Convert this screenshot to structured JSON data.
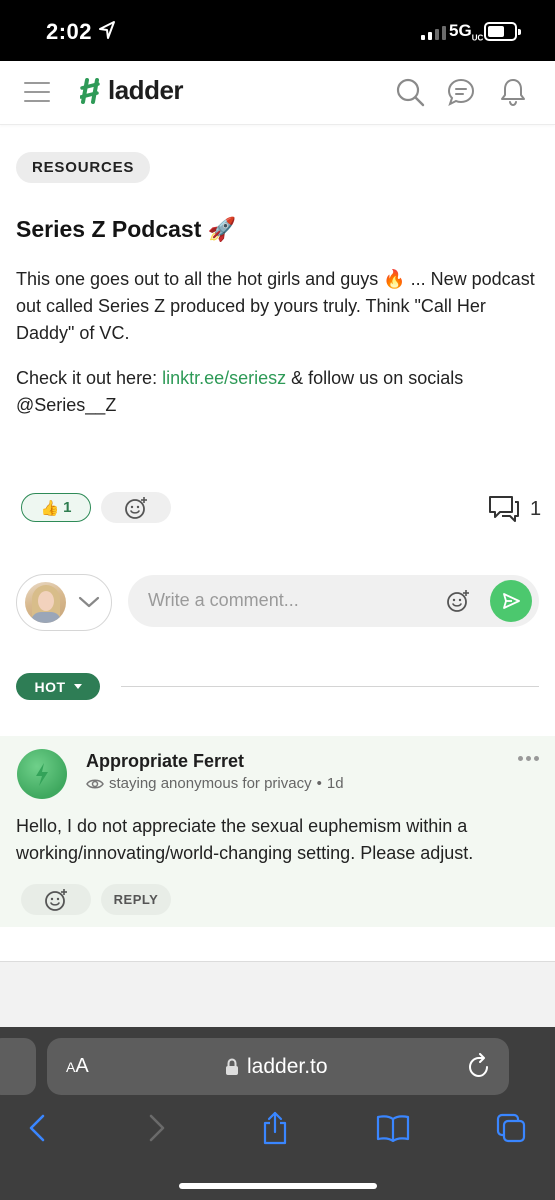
{
  "status_bar": {
    "time": "2:02",
    "network": "5G",
    "network_suffix": "UC"
  },
  "header": {
    "brand": "ladder",
    "brand_color": "#2e9a57",
    "icons": [
      "menu-icon",
      "search-icon",
      "messages-icon",
      "notifications-icon"
    ]
  },
  "post": {
    "category": "RESOURCES",
    "title": "Series Z Podcast",
    "title_emoji": "🚀",
    "paragraph1": "This one goes out to all the hot girls and guys 🔥 ... New podcast out called Series Z produced by yours truly. Think \"Call Her Daddy\" of VC.",
    "paragraph2_prefix": "Check it out here: ",
    "link_text": "linktr.ee/seriesz",
    "paragraph2_suffix": " & follow us on socials @Series__Z",
    "like_emoji": "👍",
    "like_count": "1",
    "comment_count": "1"
  },
  "composer": {
    "placeholder": "Write a comment...",
    "send_color": "#4cc86e"
  },
  "sort": {
    "label": "HOT",
    "color": "#2e7d55"
  },
  "comment": {
    "author": "Appropriate Ferret",
    "visibility": "staying anonymous for privacy",
    "separator": "•",
    "age": "1d",
    "text": "Hello, I do not appreciate the sexual euphemism within a working/innovating/world-changing setting. Please adjust.",
    "reply_label": "REPLY"
  },
  "browser": {
    "aa_large": "A",
    "aa_small": "A",
    "url": "ladder.to"
  }
}
